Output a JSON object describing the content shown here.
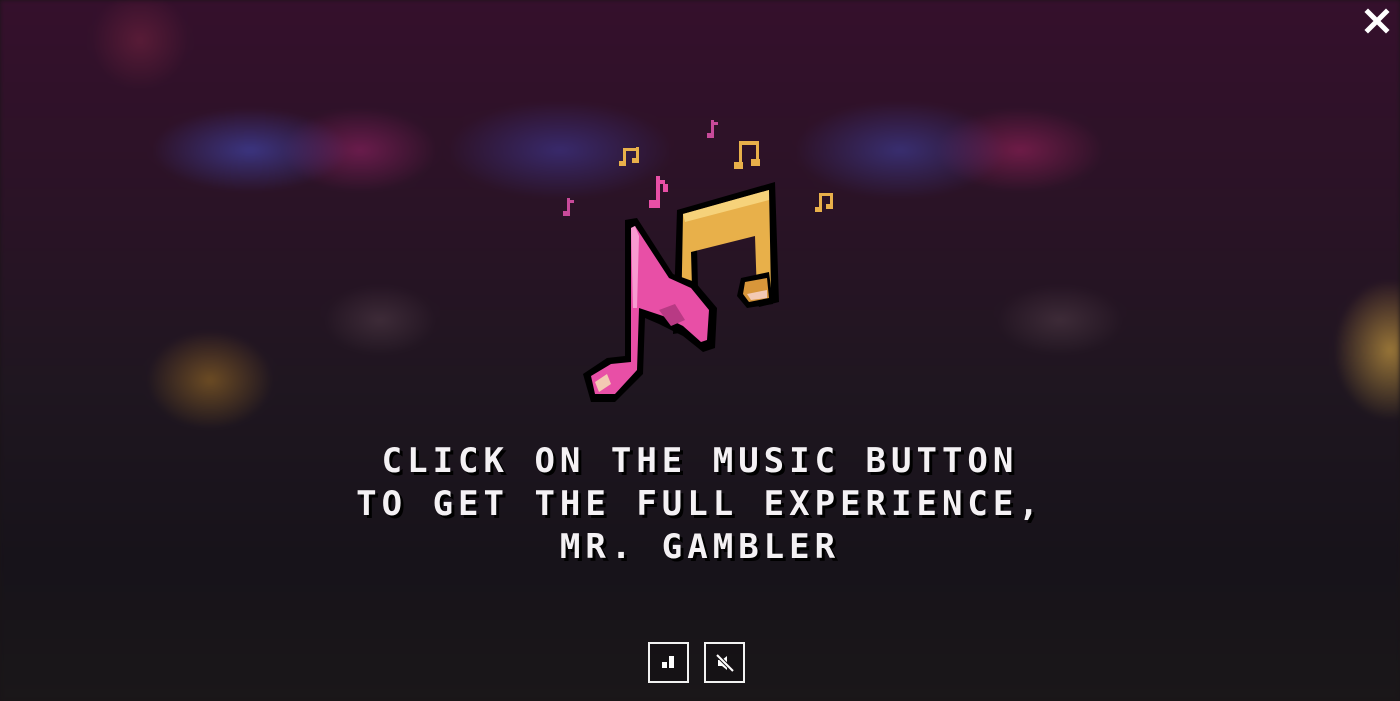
{
  "overlay": {
    "message_lines": [
      "CLICK ON THE MUSIC BUTTON",
      "TO GET THE FULL EXPERIENCE,",
      "MR. GAMBLER"
    ]
  },
  "icons": {
    "close": "close-icon",
    "hero": "music-notes-icon",
    "volume": "volume-bars-icon",
    "mute": "speaker-muted-icon"
  },
  "colors": {
    "note_pink": "#e84fa6",
    "note_gold": "#e8b04a",
    "text": "#f4f1f4"
  }
}
